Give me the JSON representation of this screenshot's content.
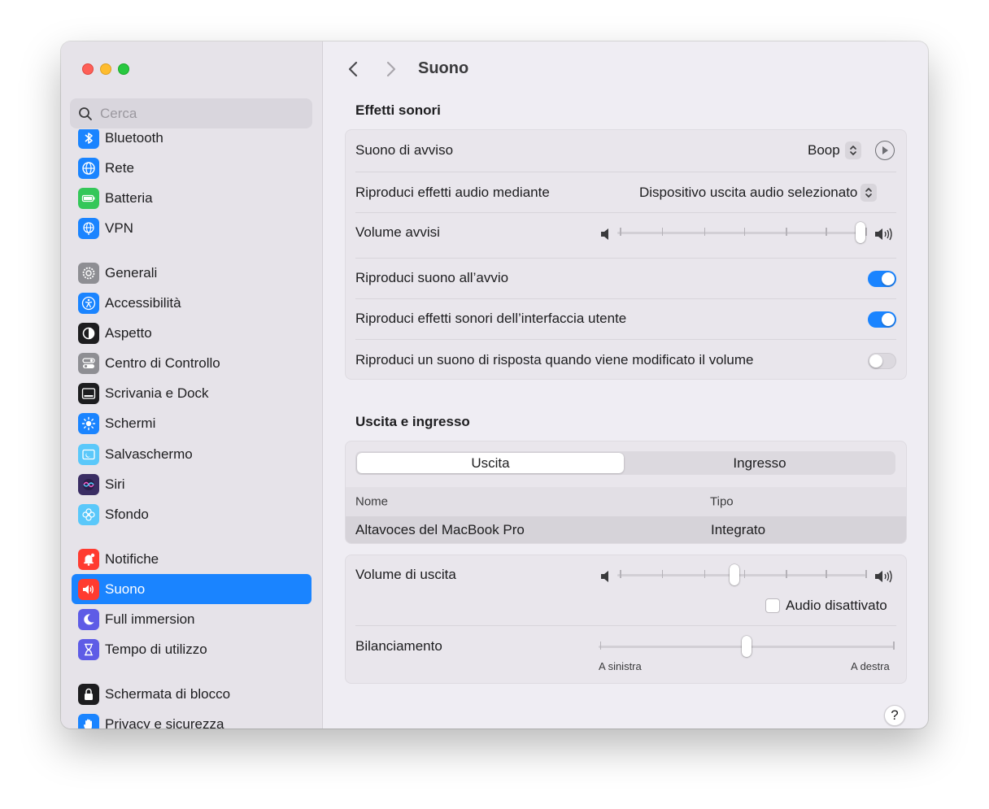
{
  "window": {
    "title": "Suono"
  },
  "sidebar": {
    "search_placeholder": "Cerca",
    "items": [
      {
        "label": "Bluetooth",
        "icon": "bluetooth-icon",
        "color": "#1a84ff"
      },
      {
        "label": "Rete",
        "icon": "globe-icon",
        "color": "#1a84ff"
      },
      {
        "label": "Batteria",
        "icon": "battery-icon",
        "color": "#34c759"
      },
      {
        "label": "VPN",
        "icon": "vpn-globe-icon",
        "color": "#1a84ff"
      },
      {
        "label": "Generali",
        "icon": "gear-icon",
        "color": "#8e8e93"
      },
      {
        "label": "Accessibilità",
        "icon": "accessibility-icon",
        "color": "#1a84ff"
      },
      {
        "label": "Aspetto",
        "icon": "appearance-icon",
        "color": "#1d1d1f"
      },
      {
        "label": "Centro di Controllo",
        "icon": "control-center-icon",
        "color": "#8e8e93"
      },
      {
        "label": "Scrivania e Dock",
        "icon": "desktop-dock-icon",
        "color": "#1d1d1f"
      },
      {
        "label": "Schermi",
        "icon": "sun-icon",
        "color": "#1a84ff"
      },
      {
        "label": "Salvaschermo",
        "icon": "screensaver-icon",
        "color": "#5ac8fa"
      },
      {
        "label": "Siri",
        "icon": "siri-icon",
        "color": "#3a2d63"
      },
      {
        "label": "Sfondo",
        "icon": "flower-icon",
        "color": "#5ac8fa"
      },
      {
        "label": "Notifiche",
        "icon": "bell-icon",
        "color": "#ff3b30"
      },
      {
        "label": "Suono",
        "icon": "speaker-icon",
        "color": "#ff3b30",
        "active": true
      },
      {
        "label": "Full immersion",
        "icon": "moon-icon",
        "color": "#5e5ce6"
      },
      {
        "label": "Tempo di utilizzo",
        "icon": "hourglass-icon",
        "color": "#5e5ce6"
      },
      {
        "label": "Schermata di blocco",
        "icon": "lock-icon",
        "color": "#1d1d1f"
      },
      {
        "label": "Privacy e sicurezza",
        "icon": "hand-icon",
        "color": "#1a84ff"
      }
    ]
  },
  "sound_effects": {
    "title": "Effetti sonori",
    "alert_sound_label": "Suono di avviso",
    "alert_sound_value": "Boop",
    "play_effects_label": "Riproduci effetti audio mediante",
    "play_effects_value": "Dispositivo uscita audio selezionato",
    "alert_volume_label": "Volume avvisi",
    "alert_volume": 1.0,
    "startup_sound_label": "Riproduci suono all’avvio",
    "startup_sound_on": true,
    "ui_sounds_label": "Riproduci effetti sonori dell’interfaccia utente",
    "ui_sounds_on": true,
    "feedback_label": "Riproduci un suono di risposta quando viene modificato il volume",
    "feedback_on": false
  },
  "output_input": {
    "title": "Uscita e ingresso",
    "tab_output": "Uscita",
    "tab_input": "Ingresso",
    "col_name": "Nome",
    "col_type": "Tipo",
    "devices": [
      {
        "name": "Altavoces del MacBook Pro",
        "type": "Integrato"
      }
    ],
    "output_volume_label": "Volume di uscita",
    "output_volume": 0.47,
    "mute_label": "Audio disattivato",
    "muted": false,
    "balance_label": "Bilanciamento",
    "balance": 0.5,
    "balance_left": "A sinistra",
    "balance_right": "A destra"
  },
  "help_label": "?"
}
